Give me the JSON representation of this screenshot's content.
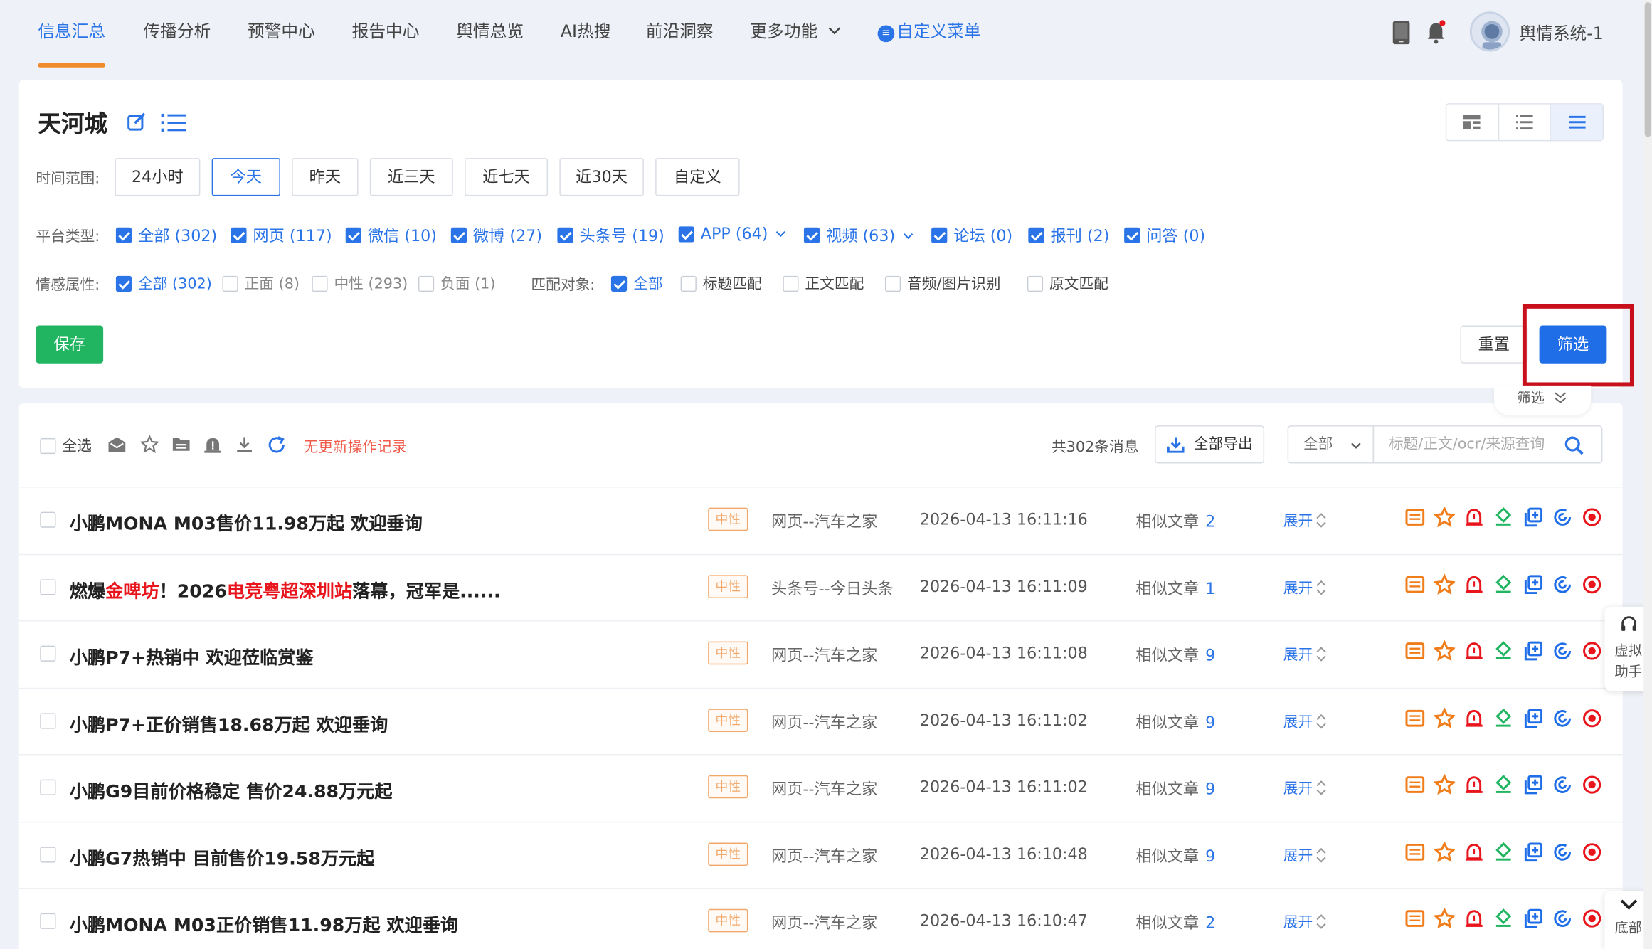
{
  "nav": {
    "tabs": [
      {
        "label": "信息汇总",
        "active": true
      },
      {
        "label": "传播分析"
      },
      {
        "label": "预警中心"
      },
      {
        "label": "报告中心"
      },
      {
        "label": "舆情总览"
      },
      {
        "label": "AI热搜"
      },
      {
        "label": "前沿洞察"
      },
      {
        "label": "更多功能"
      }
    ],
    "custom_menu": "自定义菜单",
    "user": "舆情系统-1"
  },
  "filter": {
    "title": "天河城",
    "time_label": "时间范围:",
    "time_options": [
      "24小时",
      "今天",
      "昨天",
      "近三天",
      "近七天",
      "近30天",
      "自定义"
    ],
    "time_selected": "今天",
    "platform_label": "平台类型:",
    "platforms": [
      "全部 (302)",
      "网页 (117)",
      "微信 (10)",
      "微博 (27)",
      "头条号 (19)",
      "APP (64)",
      "视频 (63)",
      "论坛 (0)",
      "报刊 (2)",
      "问答 (0)"
    ],
    "sentiment_label": "情感属性:",
    "sentiments": [
      "全部 (302)",
      "正面 (8)",
      "中性 (293)",
      "负面 (1)"
    ],
    "match_label": "匹配对象:",
    "match_options": [
      "全部",
      "标题匹配",
      "正文匹配",
      "音频/图片识别",
      "原文匹配"
    ],
    "save": "保存",
    "reset": "重置",
    "submit": "筛选",
    "collapse": "筛选"
  },
  "list": {
    "select_all": "全选",
    "no_log": "无更新操作记录",
    "total": "共302条消息",
    "export": "全部导出",
    "scope": "全部",
    "search_placeholder": "标题/正文/ocr/来源查询",
    "similar_label": "相似文章",
    "expand_label": "展开",
    "rows": [
      {
        "title": "小鹏MONA M03售价11.98万起 欢迎垂询",
        "sentiment": "中性",
        "source": "网页--汽车之家",
        "time": "2026-04-13 16:11:16",
        "similar": "2"
      },
      {
        "title_parts": [
          "燃爆",
          "金啤坊",
          "！2026",
          "电竞粤超深圳站",
          "落幕，冠军是......"
        ],
        "sentiment": "中性",
        "source": "头条号--今日头条",
        "time": "2026-04-13 16:11:09",
        "similar": "1"
      },
      {
        "title": "小鹏P7+热销中 欢迎莅临赏鉴",
        "sentiment": "中性",
        "source": "网页--汽车之家",
        "time": "2026-04-13 16:11:08",
        "similar": "9"
      },
      {
        "title": "小鹏P7+正价销售18.68万起 欢迎垂询",
        "sentiment": "中性",
        "source": "网页--汽车之家",
        "time": "2026-04-13 16:11:02",
        "similar": "9"
      },
      {
        "title": "小鹏G9目前价格稳定 售价24.88万元起",
        "sentiment": "中性",
        "source": "网页--汽车之家",
        "time": "2026-04-13 16:11:02",
        "similar": "9"
      },
      {
        "title": "小鹏G7热销中 目前售价19.58万元起",
        "sentiment": "中性",
        "source": "网页--汽车之家",
        "time": "2026-04-13 16:10:48",
        "similar": "9"
      },
      {
        "title": "小鹏MONA M03正价销售11.98万起 欢迎垂询",
        "sentiment": "中性",
        "source": "网页--汽车之家",
        "time": "2026-04-13 16:10:47",
        "similar": "2"
      }
    ]
  },
  "float": {
    "assistant_line1": "虚拟",
    "assistant_line2": "助手",
    "bottom": "底部"
  },
  "colors": {
    "accent": "#2a74e8",
    "active_underline": "#f08a2b",
    "save_green": "#21b562",
    "highlight_red": "#c8101c",
    "keyword_red": "#e8151c"
  }
}
